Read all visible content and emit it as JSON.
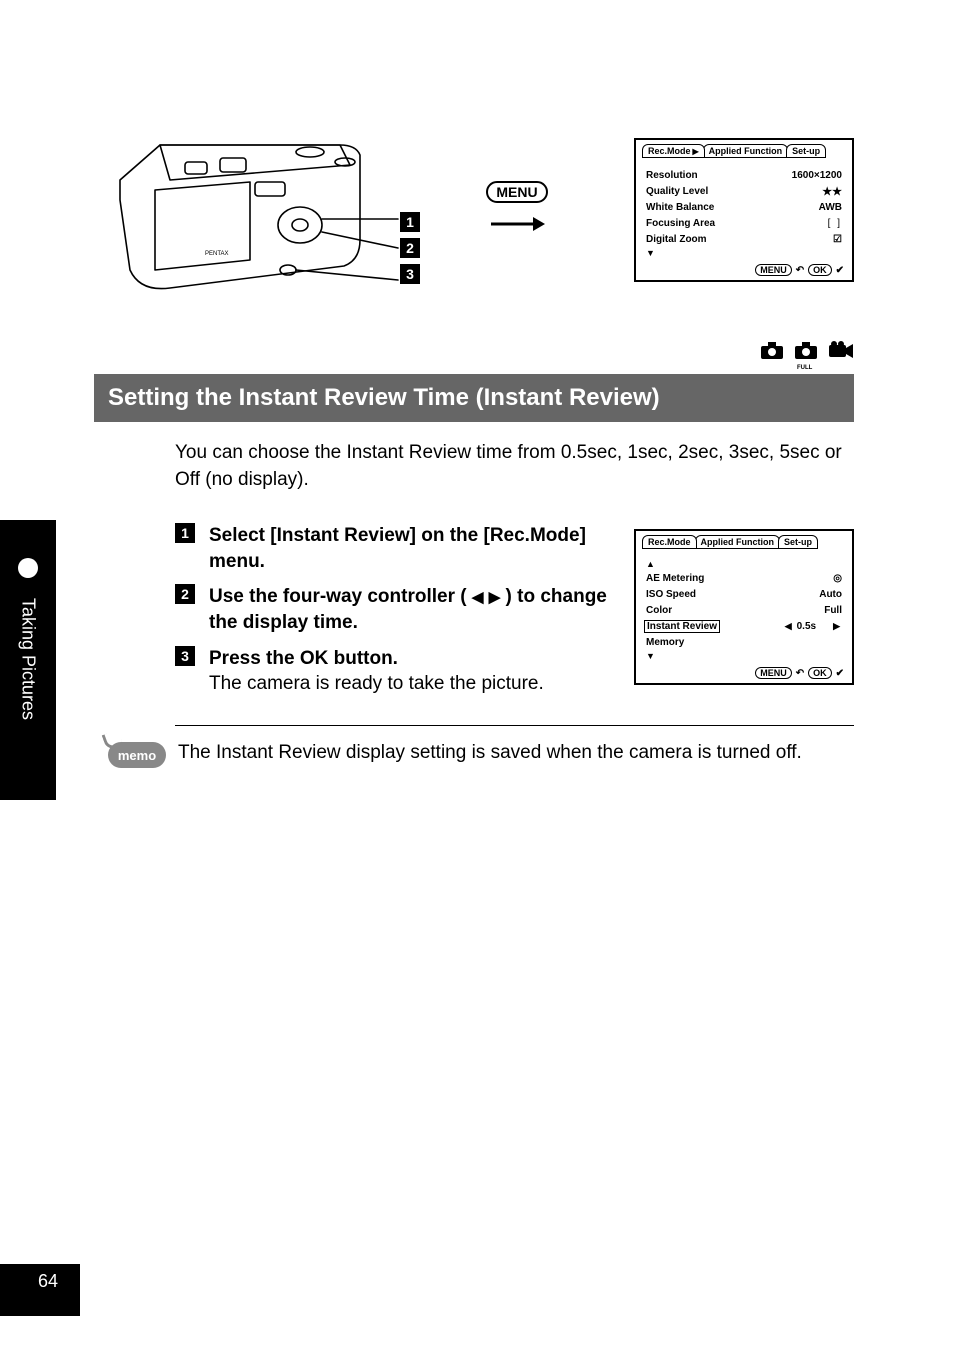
{
  "sideTabLabel": "Taking Pictures",
  "pageNumber": "64",
  "topMenuLabel": "MENU",
  "lcd1": {
    "tabs": [
      "Rec.Mode",
      "Applied Function",
      "Set-up"
    ],
    "activeTabIndex": 0,
    "items": [
      {
        "label": "Resolution",
        "value": "1600×1200"
      },
      {
        "label": "Quality Level",
        "value": "★★"
      },
      {
        "label": "White Balance",
        "value": "AWB"
      },
      {
        "label": "Focusing Area",
        "value": "[    ]"
      },
      {
        "label": "Digital Zoom",
        "value": "☑"
      }
    ],
    "footerMenu": "MENU",
    "footerReturn": "↶",
    "footerOk": "OK",
    "footerCheck": "✔"
  },
  "sectionTitle": "Setting the Instant Review Time (Instant Review)",
  "introText": "You can choose the Instant Review time from 0.5sec, 1sec, 2sec, 3sec, 5sec or Off (no display).",
  "steps": [
    {
      "num": "1",
      "title": "Select [Instant Review] on the [Rec.Mode] menu."
    },
    {
      "num": "2",
      "titlePrefix": "Use the four-way controller ( ",
      "titleSuffix": " ) to change the display time."
    },
    {
      "num": "3",
      "title": "Press the OK button.",
      "text": "The camera is ready to take the picture."
    }
  ],
  "lcd2": {
    "tabs": [
      "Rec.Mode",
      "Applied Function",
      "Set-up"
    ],
    "activeTabIndex": 0,
    "items": [
      {
        "label": "AE Metering",
        "value": "◎"
      },
      {
        "label": "ISO Speed",
        "value": "Auto"
      },
      {
        "label": "Color",
        "value": "Full"
      },
      {
        "label": "Instant Review",
        "value": "0.5s",
        "selected": true
      },
      {
        "label": "Memory",
        "value": ""
      }
    ],
    "footerMenu": "MENU",
    "footerReturn": "↶",
    "footerOk": "OK",
    "footerCheck": "✔"
  },
  "memoLabel": "memo",
  "memoText": "The Instant Review display setting is saved when the camera is turned off.",
  "callouts": [
    "1",
    "2",
    "3"
  ]
}
